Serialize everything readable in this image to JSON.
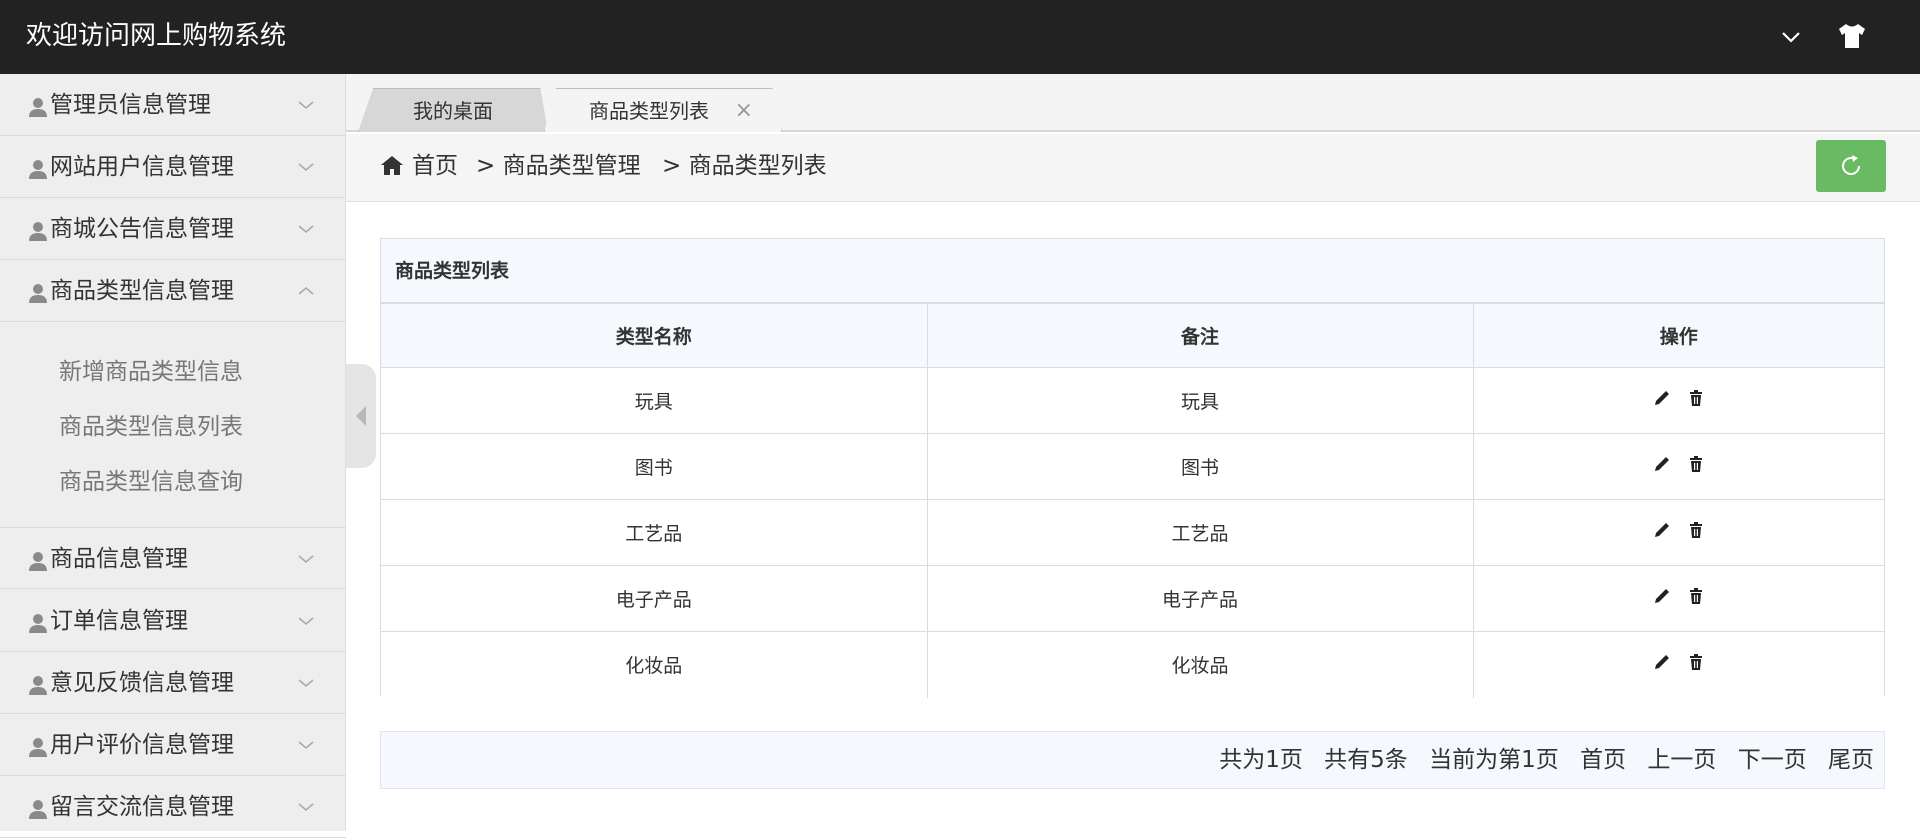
{
  "app": {
    "title": "欢迎访问网上购物系统",
    "icons": [
      "chevron-down-icon",
      "shirt-icon"
    ]
  },
  "sidebar": {
    "items": [
      {
        "label": "管理员信息管理",
        "expanded": false
      },
      {
        "label": "网站用户信息管理",
        "expanded": false
      },
      {
        "label": "商城公告信息管理",
        "expanded": false
      },
      {
        "label": "商品类型信息管理",
        "expanded": true
      },
      {
        "label": "商品信息管理",
        "expanded": false
      },
      {
        "label": "订单信息管理",
        "expanded": false
      },
      {
        "label": "意见反馈信息管理",
        "expanded": false
      },
      {
        "label": "用户评价信息管理",
        "expanded": false
      },
      {
        "label": "留言交流信息管理",
        "expanded": false
      }
    ],
    "subitems": [
      "新增商品类型信息",
      "商品类型信息列表",
      "商品类型信息查询"
    ]
  },
  "tabs": [
    {
      "label": "我的桌面",
      "active": false
    },
    {
      "label": "商品类型列表",
      "active": true,
      "close": "×"
    }
  ],
  "breadcrumb": {
    "home": "首页",
    "level1": "> 商品类型管理",
    "level2": ">  商品类型列表"
  },
  "panel": {
    "title": "商品类型列表",
    "columns": [
      "类型名称",
      "备注",
      "操作"
    ],
    "rows": [
      {
        "name": "玩具",
        "note": "玩具"
      },
      {
        "name": "图书",
        "note": "图书"
      },
      {
        "name": "工艺品",
        "note": "工艺品"
      },
      {
        "name": "电子产品",
        "note": "电子产品"
      },
      {
        "name": "化妆品",
        "note": "化妆品"
      }
    ]
  },
  "pagination": {
    "total_pages": "共为1页",
    "total_items": "共有5条",
    "current": "当前为第1页",
    "first": "首页",
    "prev": "上一页",
    "next": "下一页",
    "last": "尾页"
  },
  "colors": {
    "header_bg": "#222222",
    "refresh_button": "#6ab963",
    "sidebar_bg": "#eeeeee"
  }
}
